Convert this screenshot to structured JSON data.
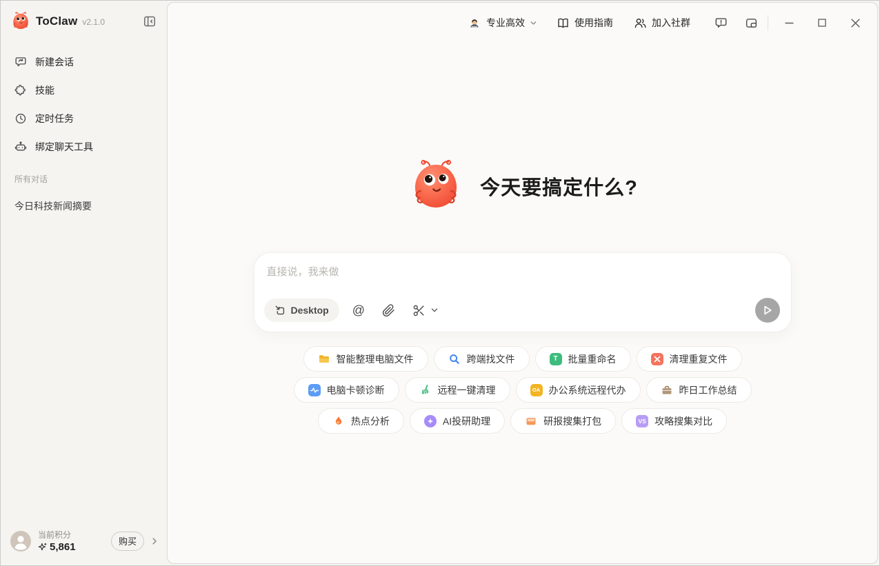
{
  "brand": {
    "name": "ToClaw",
    "version": "v2.1.0",
    "mascot": "crab-mascot"
  },
  "sidebar": {
    "nav": [
      {
        "label": "新建会话",
        "icon": "new-chat-icon"
      },
      {
        "label": "技能",
        "icon": "skills-puzzle-icon"
      },
      {
        "label": "定时任务",
        "icon": "clock-icon"
      },
      {
        "label": "绑定聊天工具",
        "icon": "robot-icon"
      }
    ],
    "section_label": "所有对话",
    "conversations": [
      {
        "title": "今日科技新闻摘要"
      }
    ],
    "footer": {
      "points_label": "当前积分",
      "points_value": "5,861",
      "points_icon": "sparkle-points-icon",
      "buy_button": "购买"
    }
  },
  "topbar": {
    "mode": {
      "label": "专业高效",
      "icon": "technologist-avatar-icon",
      "chevron": "chevron-down-icon"
    },
    "guide": {
      "label": "使用指南",
      "icon": "book-icon"
    },
    "community": {
      "label": "加入社群",
      "icon": "people-icon"
    },
    "action_icons": [
      "feedback-icon",
      "mini-window-icon"
    ],
    "window_controls": [
      "minimize",
      "maximize",
      "close"
    ]
  },
  "hero": {
    "title": "今天要搞定什么?"
  },
  "composer": {
    "placeholder": "直接说，我来做",
    "desktop_button": "Desktop",
    "mention_glyph": "@",
    "icons": [
      "desktop-switch-icon",
      "mention-icon",
      "attachment-icon",
      "scissors-icon",
      "chevron-down-icon",
      "send-icon"
    ]
  },
  "suggestions": {
    "rows": [
      {
        "items": [
          {
            "label": "智能整理电脑文件",
            "icon": "folder-icon",
            "color": "#f0b429"
          },
          {
            "label": "跨端找文件",
            "icon": "search-icon",
            "color": "#4285f4"
          },
          {
            "label": "批量重命名",
            "icon": "rename-badge-icon",
            "glyph": "T",
            "color": "#3dbd7d"
          },
          {
            "label": "清理重复文件",
            "icon": "clean-duplicates-icon",
            "color": "#f4735c"
          }
        ]
      },
      {
        "items": [
          {
            "label": "电脑卡顿诊断",
            "icon": "diagnosis-pulse-icon",
            "color": "#5b9cf6"
          },
          {
            "label": "远程一键清理",
            "icon": "broom-icon",
            "color": "#3dbd7d"
          },
          {
            "label": "办公系统远程代办",
            "icon": "oa-badge-icon",
            "glyph": "OA",
            "color": "#f2b424"
          },
          {
            "label": "昨日工作总结",
            "icon": "briefcase-icon",
            "color": "#b0977a"
          }
        ]
      },
      {
        "items": [
          {
            "label": "热点分析",
            "icon": "flame-icon",
            "color": "#f9793a"
          },
          {
            "label": "AI投研助理",
            "icon": "ai-star-icon",
            "color": "#a78bfa"
          },
          {
            "label": "研报搜集打包",
            "icon": "report-folder-icon",
            "color": "#f59857"
          },
          {
            "label": "攻略搜集对比",
            "icon": "vs-badge-icon",
            "glyph": "VS",
            "color": "#b79df5"
          }
        ]
      }
    ]
  },
  "colors": {
    "brand_coral": "#f4523b",
    "window_bg": "#f5f4f0",
    "panel_bg": "#fbfaf8",
    "text_primary": "#262626",
    "text_muted": "#8f8d88",
    "send_button": "#a6a6a6",
    "chip_border": "#eceae5"
  }
}
